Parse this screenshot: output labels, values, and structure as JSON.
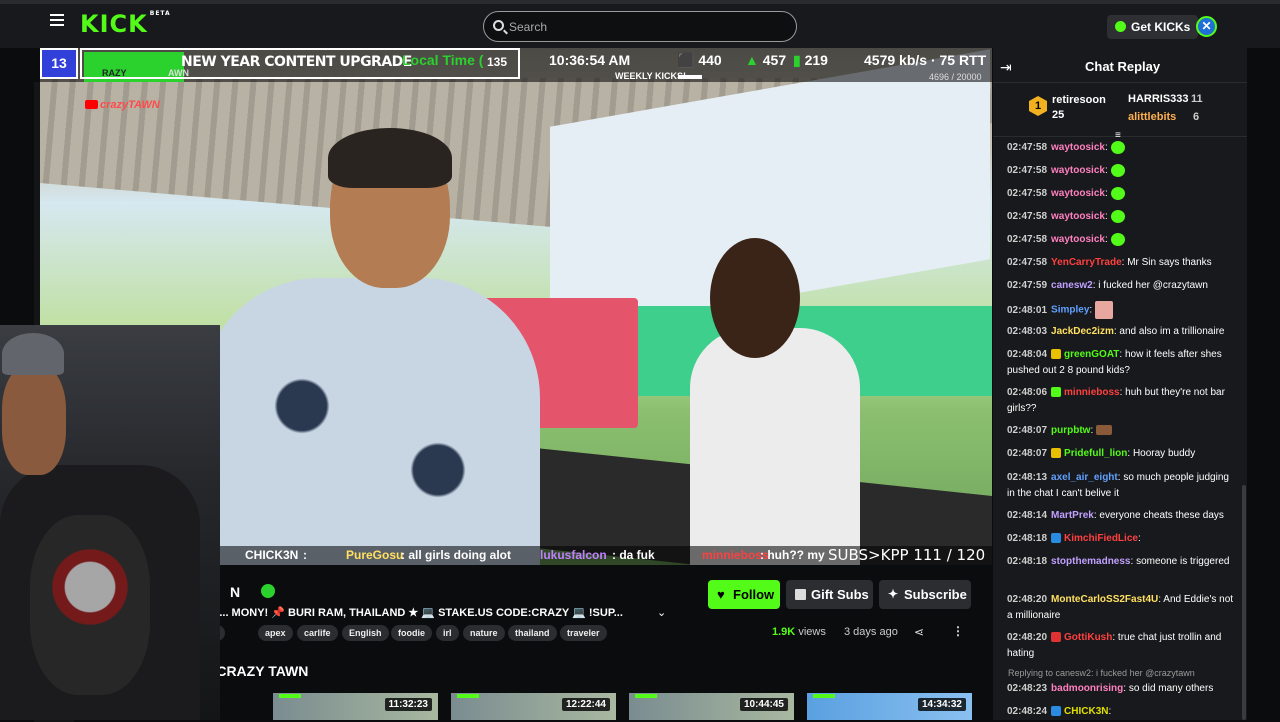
{
  "topbar": {
    "logo": "KICK",
    "logo_sup": "BETA",
    "search_placeholder": "Search",
    "get_kicks": "Get KICKs"
  },
  "overlay": {
    "rank": "13",
    "title": "NEW YEAR CONTENT UPGRADE",
    "name_left": "RAZY",
    "name_right": "AWN",
    "count": "135",
    "local_time_label": "Local Time (",
    "time": "10:36:54 AM",
    "stat_kicks": "440",
    "stat_viewers": "457",
    "stat_bars": "219",
    "bitrate": "4579 kb/s · 75 RTT",
    "weekly_label": "WEEKLY KICKS!",
    "weekly_count": "4696 / 20000",
    "yt_name": "crazyTAWN"
  },
  "ticker": [
    {
      "user": "CHICK3N",
      "msg": ":",
      "color": "#e0e000"
    },
    {
      "user": "PureGosu",
      "msg": ": all girls doing alot",
      "color": "#ffe060"
    },
    {
      "user": "lukusfalcon",
      "msg": ": da fuk",
      "color": "#c080ff"
    },
    {
      "user": "minnieboss",
      "msg": ": huh?? my",
      "color": "#ff4040"
    }
  ],
  "subs_counter": "SUBS>KPP  111 / 120",
  "stream": {
    "name": "N",
    "title": "TEPD... MONY! 📌 BURI RAM, THAILAND ★ 💻 STAKE.US CODE:CRAZY 💻 !SUP...",
    "tags": [
      "glish",
      "apex",
      "carlife",
      "English",
      "foodie",
      "irl",
      "nature",
      "thailand",
      "traveler"
    ],
    "follow": "Follow",
    "gift_subs": "Gift Subs",
    "subscribe": "Subscribe",
    "views_num": "1.9K",
    "views_label": "views",
    "ago": "3 days ago",
    "from_heading": "m CRAZY TAWN"
  },
  "thumbnails": [
    {
      "duration": "11:32:23"
    },
    {
      "duration": "12:22:44"
    },
    {
      "duration": "10:44:45"
    },
    {
      "duration": "14:34:32"
    }
  ],
  "chat": {
    "title": "Chat Replay",
    "leaders": [
      {
        "rank": "1",
        "name": "retiresoon",
        "count": "25"
      },
      {
        "name": "HARRIS333",
        "count": "11"
      },
      {
        "name": "alittlebits",
        "count": "6"
      }
    ],
    "messages": [
      {
        "time": "02:47:58",
        "user": "waytoosick",
        "color": "#ff80c0",
        "text": "",
        "emote": "green"
      },
      {
        "time": "02:47:58",
        "user": "waytoosick",
        "color": "#ff80c0",
        "text": "",
        "emote": "green"
      },
      {
        "time": "02:47:58",
        "user": "waytoosick",
        "color": "#ff80c0",
        "text": "",
        "emote": "green"
      },
      {
        "time": "02:47:58",
        "user": "waytoosick",
        "color": "#ff80c0",
        "text": "",
        "emote": "green"
      },
      {
        "time": "02:47:58",
        "user": "waytoosick",
        "color": "#ff80c0",
        "text": "",
        "emote": "green"
      },
      {
        "time": "02:47:58",
        "user": "YenCarryTrade",
        "color": "#ff4040",
        "text": "Mr Sin says thanks"
      },
      {
        "time": "02:47:59",
        "user": "canesw2",
        "color": "#c0a0ff",
        "text": "i fucked her @crazytawn"
      },
      {
        "time": "02:48:01",
        "user": "Simpley",
        "color": "#60a0ff",
        "text": "",
        "emote": "sq"
      },
      {
        "time": "02:48:03",
        "user": "JackDec2izm",
        "color": "#ffe060",
        "text": "and also im a trillionaire"
      },
      {
        "time": "02:48:04",
        "user": "greenGOAT",
        "color": "#53fc18",
        "text": "how it feels after shes pushed out 2 8 pound kids?",
        "badge": "y"
      },
      {
        "time": "02:48:06",
        "user": "minnieboss",
        "color": "#ff4040",
        "text": "huh but they're not bar girls??",
        "badge": "g"
      },
      {
        "time": "02:48:07",
        "user": "purpbtw",
        "color": "#53fc18",
        "text": "",
        "emote": "brown"
      },
      {
        "time": "02:48:07",
        "user": "Pridefull_lion",
        "color": "#53fc18",
        "text": "Hooray buddy",
        "badge": "y"
      },
      {
        "time": "02:48:13",
        "user": "axel_air_eight",
        "color": "#60a0ff",
        "text": "so much people judging in the chat I can't belive it"
      },
      {
        "time": "02:48:14",
        "user": "MartPrek",
        "color": "#c0a0ff",
        "text": "everyone cheats these days"
      },
      {
        "time": "02:48:18",
        "user": "KimchiFiedLice",
        "color": "#ff4040",
        "text": "",
        "badge": "b"
      },
      {
        "time": "02:48:18",
        "user": "stopthemadness",
        "color": "#c0a0ff",
        "text": "someone is triggered"
      },
      {
        "time": "02:48:20",
        "user": "MonteCarloSS2Fast4U",
        "color": "#ffe060",
        "text": "And Eddie's not a millionaire"
      },
      {
        "time": "02:48:20",
        "user": "GottiKush",
        "color": "#ff4040",
        "text": "true chat just trollin and hating",
        "badge": "r"
      },
      {
        "time": "02:48:23",
        "user": "badmoonrising",
        "color": "#ff80c0",
        "text": "so did many others"
      },
      {
        "time": "02:48:24",
        "user": "CHICK3N",
        "color": "#e0e000",
        "text": "",
        "badge": "b"
      }
    ],
    "reply_note": "Replying to canesw2: i fucked her @crazytawn"
  }
}
